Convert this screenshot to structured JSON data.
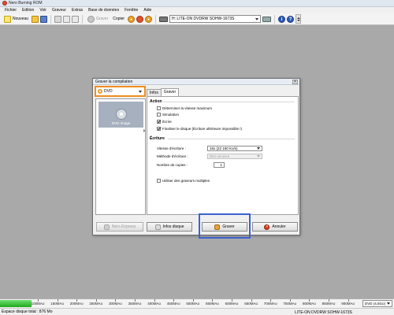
{
  "window": {
    "title": "Nero Burning ROM"
  },
  "menu": [
    "Fichier",
    "Edition",
    "Voir",
    "Graveur",
    "Extras",
    "Base de données",
    "Fenêtre",
    "Aide"
  ],
  "toolbar": {
    "new_label": "Nouveau",
    "burn_label": "Graver",
    "copy_label": "Copier",
    "drive": "H: LITE-ON DVDRW SOHW-1673S"
  },
  "dialog": {
    "title": "Graver la compilation",
    "disc_type": "DVD",
    "left_item": "DVD Image",
    "tabs": [
      "Infos",
      "Graver"
    ],
    "action_header": "Action",
    "actions": [
      {
        "label": "Déterminer la vitesse maximum",
        "checked": false
      },
      {
        "label": "Simulation",
        "checked": false
      },
      {
        "label": "Écrire",
        "checked": true
      },
      {
        "label": "Finaliser le disque (Écriture ultérieure impossible !)",
        "checked": true
      }
    ],
    "writing_header": "Écriture",
    "speed_label": "Vitesse d'écriture :",
    "speed_value": "16x (22 160 Ko/s)",
    "method_label": "Méthode d'écriture :",
    "method_value": "Disc-at-once",
    "copies_label": "Nombre de copies :",
    "copies_value": "1",
    "multi_label": "Utiliser des graveurs multiples",
    "buttons": {
      "express": "Nero Express",
      "disc_info": "Infos disque",
      "burn": "Graver",
      "cancel": "Annuler"
    }
  },
  "capacity": {
    "used_mb": 876,
    "ticks": [
      "100MAo",
      "150MAo",
      "200MAo",
      "250MAo",
      "300MAo",
      "350MAo",
      "400MAo",
      "450MAo",
      "500MAo",
      "550MAo",
      "600MAo",
      "650MAo",
      "700MAo",
      "750MAo",
      "800MAo",
      "850MAo",
      "900MAo"
    ],
    "disc_select": "DVD (4,5Go)"
  },
  "status": {
    "left": "Espace disque total : 876 Mo",
    "right": "LITE-ON DVDRW SOHW-1673S"
  },
  "colors": {
    "desktop": "#a9a9a9",
    "disc_type_highlight": "#f08c1e",
    "burn_highlight": "#3a63d2",
    "capacity_fill": "#2fb52f"
  }
}
